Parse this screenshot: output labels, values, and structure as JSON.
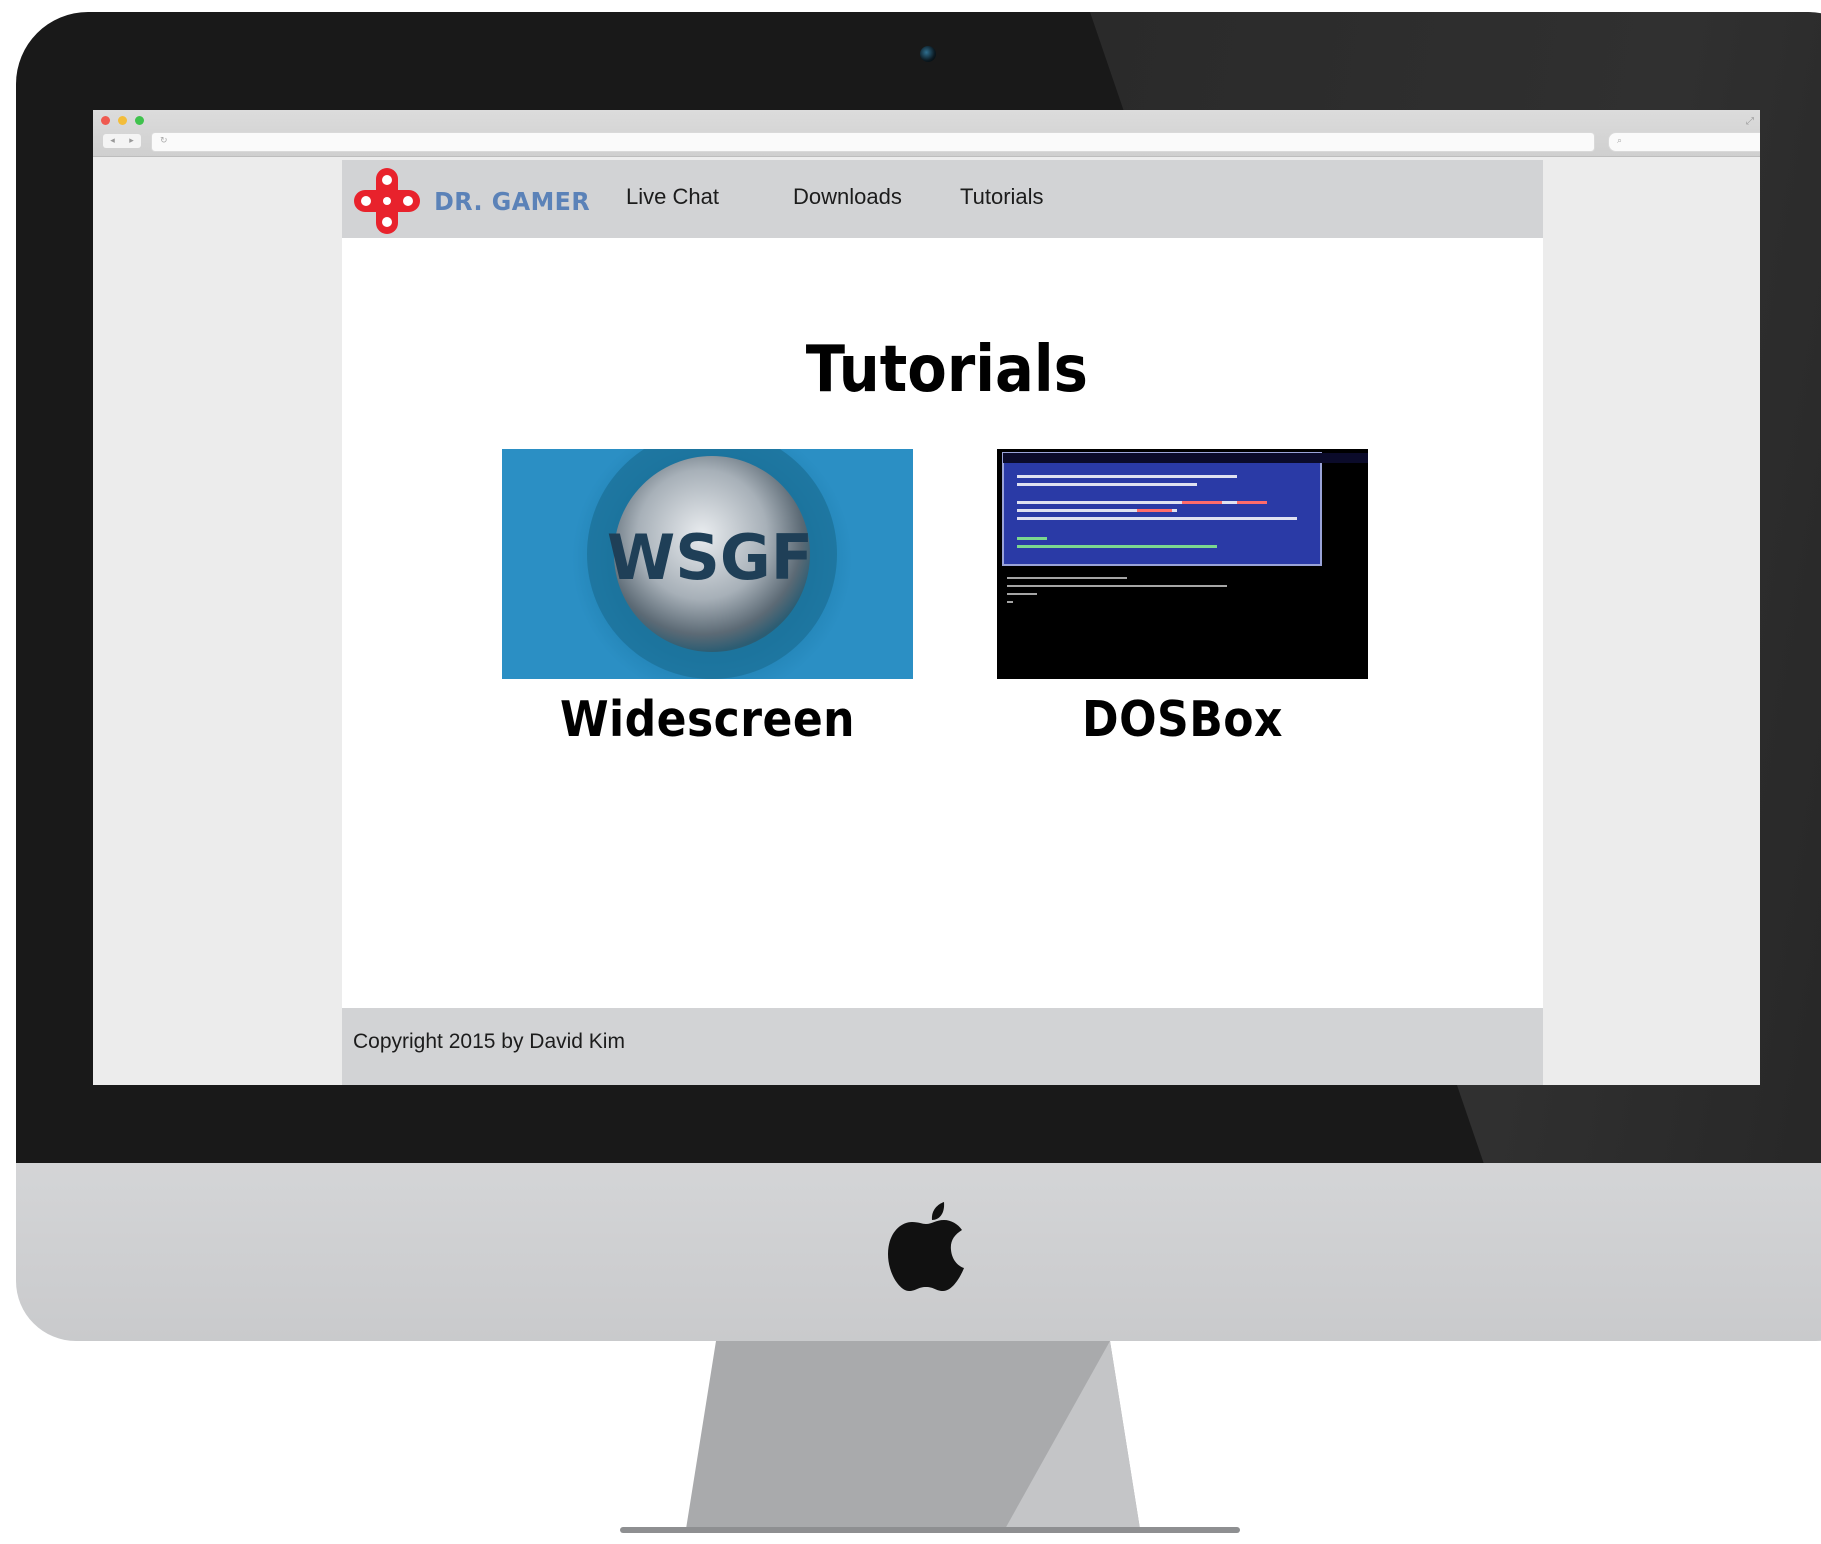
{
  "site": {
    "logo_text": "DR. GAMER",
    "nav": [
      {
        "label": "Live Chat"
      },
      {
        "label": "Downloads"
      },
      {
        "label": "Tutorials"
      }
    ],
    "page_title": "Tutorials",
    "tutorials": [
      {
        "label": "Widescreen",
        "image_text": "WSGF"
      },
      {
        "label": "DOSBox"
      }
    ],
    "footer": "Copyright 2015 by David Kim"
  },
  "colors": {
    "logo_red": "#e8222c",
    "logo_blue": "#5b82b8",
    "header_bg": "#d2d3d5",
    "wsgf_bg": "#2b8fc4",
    "dos_window": "#2a3aa6"
  }
}
